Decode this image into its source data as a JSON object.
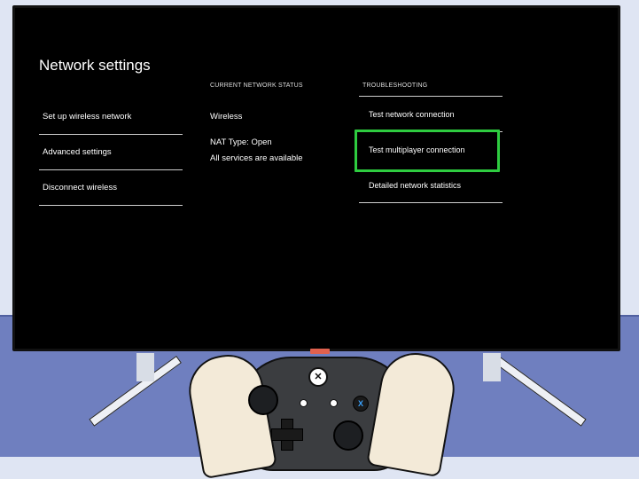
{
  "screen": {
    "title": "Network settings"
  },
  "menu": {
    "items": [
      {
        "label": "Set up wireless network"
      },
      {
        "label": "Advanced settings"
      },
      {
        "label": "Disconnect wireless"
      }
    ]
  },
  "status": {
    "heading": "CURRENT NETWORK STATUS",
    "connection": "Wireless",
    "nat": "NAT Type: Open",
    "services": "All services are available"
  },
  "troubleshooting": {
    "heading": "TROUBLESHOOTING",
    "items": [
      {
        "label": "Test network connection"
      },
      {
        "label": "Test multiplayer connection",
        "highlighted": true
      },
      {
        "label": "Detailed network statistics"
      }
    ]
  },
  "controller": {
    "x_button": "X"
  },
  "colors": {
    "highlight": "#2ecc40",
    "screen_bg": "#000000",
    "wall_top": "#dfe5f3",
    "wall_bottom": "#6f7fbf"
  }
}
